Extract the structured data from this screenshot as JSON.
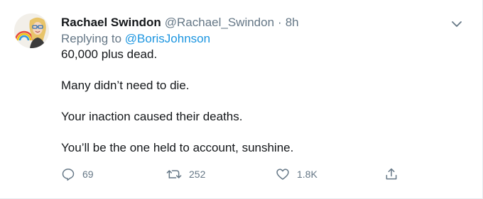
{
  "tweet": {
    "author_name": "Rachael Swindon",
    "author_handle": "@Rachael_Swindon",
    "separator": "·",
    "time": "8h",
    "replying_prefix": "Replying to",
    "replying_handle": "@BorisJohnson",
    "paragraphs": [
      "60,000 plus dead.",
      "Many didn’t need to die.",
      "Your inaction caused their deaths.",
      "You’ll be the one held to account, sunshine."
    ]
  },
  "actions": {
    "replies": "69",
    "retweets": "252",
    "likes": "1.8K"
  },
  "icons": {
    "avatar": "avatar-illustration",
    "caret": "chevron-down-icon",
    "reply": "reply-bubble-icon",
    "retweet": "retweet-icon",
    "like": "heart-icon",
    "share": "share-icon"
  },
  "colors": {
    "text": "#14171a",
    "secondary": "#657786",
    "link": "#1b95e0",
    "border": "#e6ecf0"
  }
}
